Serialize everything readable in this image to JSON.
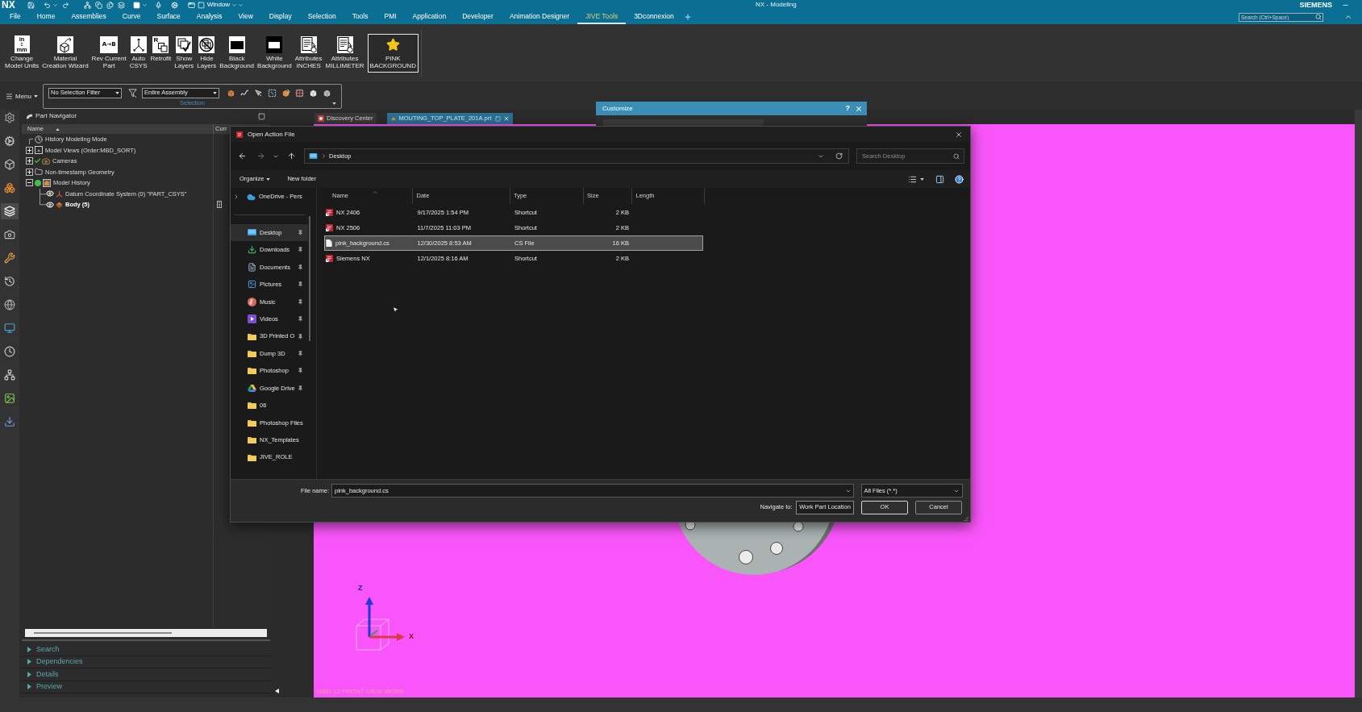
{
  "window": {
    "app_logo": "NX",
    "window_menu": "Window",
    "title": "NX - Modeling",
    "brand": "SIEMENS"
  },
  "menu_tabs": [
    {
      "label": "File",
      "selected": false
    },
    {
      "label": "Home",
      "selected": false
    },
    {
      "label": "Assemblies",
      "selected": false
    },
    {
      "label": "Curve",
      "selected": false
    },
    {
      "label": "Surface",
      "selected": false
    },
    {
      "label": "Analysis",
      "selected": false
    },
    {
      "label": "View",
      "selected": false
    },
    {
      "label": "Display",
      "selected": false
    },
    {
      "label": "Selection",
      "selected": false
    },
    {
      "label": "Tools",
      "selected": false
    },
    {
      "label": "PMI",
      "selected": false
    },
    {
      "label": "Application",
      "selected": false
    },
    {
      "label": "Developer",
      "selected": false
    },
    {
      "label": "Animation Designer",
      "selected": false
    },
    {
      "label": "JIVE Tools",
      "selected": true
    },
    {
      "label": "3Dconnexion",
      "selected": false
    }
  ],
  "command_search": {
    "placeholder": "Search (Ctrl+Space)"
  },
  "ribbon": [
    {
      "kind": "units",
      "lines": [
        "Change",
        "Model Units"
      ],
      "icon_text": [
        "in",
        "mm"
      ],
      "selected": false
    },
    {
      "kind": "wizard",
      "lines": [
        "Material",
        "Creation Wizard"
      ],
      "selected": false
    },
    {
      "kind": "rev",
      "lines": [
        "Rev Current",
        "Part"
      ],
      "icon_text": [
        "A→B"
      ],
      "selected": false
    },
    {
      "kind": "csys",
      "lines": [
        "Auto",
        "CSYS"
      ],
      "selected": false
    },
    {
      "kind": "retrofit",
      "lines": [
        "Retrofit"
      ],
      "icon_text": [
        "R"
      ],
      "selected": false
    },
    {
      "kind": "show_layers",
      "lines": [
        "Show",
        "Layers"
      ],
      "selected": false
    },
    {
      "kind": "hide_layers",
      "lines": [
        "Hide",
        "Layers"
      ],
      "selected": false
    },
    {
      "kind": "black_background",
      "lines": [
        "Black",
        "Background"
      ],
      "selected": false
    },
    {
      "kind": "white_background",
      "lines": [
        "White",
        "Background"
      ],
      "selected": false
    },
    {
      "kind": "attributes",
      "lines": [
        "Attributes",
        "INCHES"
      ],
      "selected": false
    },
    {
      "kind": "attributes",
      "lines": [
        "Attributes",
        "MILLIMETER"
      ],
      "selected": false
    },
    {
      "kind": "star",
      "lines": [
        "PINK",
        "BACKGROUND"
      ],
      "selected": true
    }
  ],
  "selection_bar": {
    "menu": "Menu",
    "type_filter": "No Selection Filter",
    "scope": "Entire Assembly",
    "group_label": "Selection"
  },
  "resource_bar": [
    {
      "kind": "settings",
      "selected": false
    },
    {
      "kind": "roles",
      "selected": false
    },
    {
      "kind": "assembly",
      "selected": false
    },
    {
      "kind": "reuse",
      "selected": false
    },
    {
      "kind": "part",
      "selected": true
    },
    {
      "kind": "view",
      "selected": false
    },
    {
      "kind": "constraints",
      "selected": false
    },
    {
      "kind": "history",
      "selected": false
    },
    {
      "kind": "sphere",
      "selected": false
    },
    {
      "kind": "web",
      "selected": false
    },
    {
      "kind": "clock",
      "selected": false
    },
    {
      "kind": "network",
      "selected": false
    },
    {
      "kind": "media",
      "selected": false
    },
    {
      "kind": "tool",
      "selected": false
    }
  ],
  "part_navigator": {
    "title": "Part Navigator",
    "columns": [
      "Name",
      "Curr"
    ],
    "tree": [
      {
        "kind": "mode",
        "label": "History Modeling Mode",
        "current": false
      },
      {
        "kind": "views",
        "label": "Model Views (Order:MBD_SORT)",
        "expanded": false,
        "current": false
      },
      {
        "kind": "cameras",
        "label": "Cameras",
        "expanded": false,
        "current": false
      },
      {
        "kind": "folder",
        "label": "Non-timestamp Geometry",
        "expanded": false,
        "current": false
      },
      {
        "kind": "history",
        "label": "Model History",
        "expanded": true,
        "current": false,
        "children": [
          {
            "kind": "csys",
            "label": "Datum Coordinate System (0) \"PART_CSYS\"",
            "visible": true,
            "current": false
          },
          {
            "kind": "body",
            "label": "Body (5)",
            "visible": true,
            "current": true
          }
        ]
      }
    ],
    "panels": [
      {
        "label": "Search",
        "expanded": false
      },
      {
        "label": "Dependencies",
        "expanded": false
      },
      {
        "label": "Details",
        "expanded": false
      },
      {
        "label": "Preview",
        "expanded": false
      }
    ]
  },
  "viewport": {
    "tabs": [
      {
        "label": "Discovery Center",
        "selected": false
      },
      {
        "label": "MOUTING_TOP_PLATE_201A.prt",
        "selected": true
      }
    ],
    "axis_labels": [
      "Z",
      "X"
    ],
    "view_label": "MBD 12 FRONT VIEW WORK"
  },
  "customize_dialog": {
    "title": "Customize",
    "help": "?"
  },
  "open_dialog": {
    "title": "Open Action File",
    "location": "Desktop",
    "search_placeholder": "Search Desktop",
    "toolbar": [
      {
        "kind": "menu",
        "label": "Organize"
      },
      {
        "kind": "button",
        "label": "New folder"
      }
    ],
    "cloud": {
      "label": "OneDrive - Pers",
      "expanded": false
    },
    "places": [
      {
        "kind": "desktop",
        "label": "Desktop",
        "pinned": true,
        "selected": true
      },
      {
        "kind": "downloads",
        "label": "Downloads",
        "pinned": true,
        "selected": false
      },
      {
        "kind": "documents",
        "label": "Documents",
        "pinned": true,
        "selected": false
      },
      {
        "kind": "pictures",
        "label": "Pictures",
        "pinned": true,
        "selected": false
      },
      {
        "kind": "music",
        "label": "Music",
        "pinned": true,
        "selected": false
      },
      {
        "kind": "videos",
        "label": "Videos",
        "pinned": true,
        "selected": false
      },
      {
        "kind": "folder",
        "label": "3D Printed O",
        "pinned": true,
        "selected": false
      },
      {
        "kind": "folder",
        "label": "Dump 3D",
        "pinned": true,
        "selected": false
      },
      {
        "kind": "folder",
        "label": "Photoshop",
        "pinned": true,
        "selected": false
      },
      {
        "kind": "drive",
        "label": "Google Drive",
        "pinned": true,
        "selected": false
      },
      {
        "kind": "folder",
        "label": "06",
        "pinned": false,
        "selected": false
      },
      {
        "kind": "folder",
        "label": "Photoshop Files",
        "pinned": false,
        "selected": false
      },
      {
        "kind": "folder",
        "label": "NX_Templates",
        "pinned": false,
        "selected": false
      },
      {
        "kind": "folder",
        "label": "JIVE_ROLE",
        "pinned": false,
        "selected": false
      }
    ],
    "columns": [
      "Name",
      "Date",
      "Type",
      "Size",
      "Length"
    ],
    "files": [
      {
        "kind": "shortcut",
        "name": "NX 2406",
        "date": "9/17/2025 1:54 PM",
        "type": "Shortcut",
        "size": "2 KB",
        "selected": false
      },
      {
        "kind": "shortcut",
        "name": "NX 2506",
        "date": "11/7/2025 11:03 PM",
        "type": "Shortcut",
        "size": "2 KB",
        "selected": false
      },
      {
        "kind": "file",
        "name": "pink_background.cs",
        "date": "12/30/2025 8:53 AM",
        "type": "CS File",
        "size": "16 KB",
        "selected": true
      },
      {
        "kind": "shortcut",
        "name": "Siemens NX",
        "date": "12/1/2025 8:16 AM",
        "type": "Shortcut",
        "size": "2 KB",
        "selected": false
      }
    ],
    "file_name_label": "File name:",
    "file_name": "pink_background.cs",
    "file_type": "All Files (*.*)",
    "navigate_label": "Navigate to:",
    "navigate_button": "Work Part Location",
    "buttons": [
      {
        "label": "OK",
        "default": true
      },
      {
        "label": "Cancel",
        "default": false
      }
    ]
  }
}
